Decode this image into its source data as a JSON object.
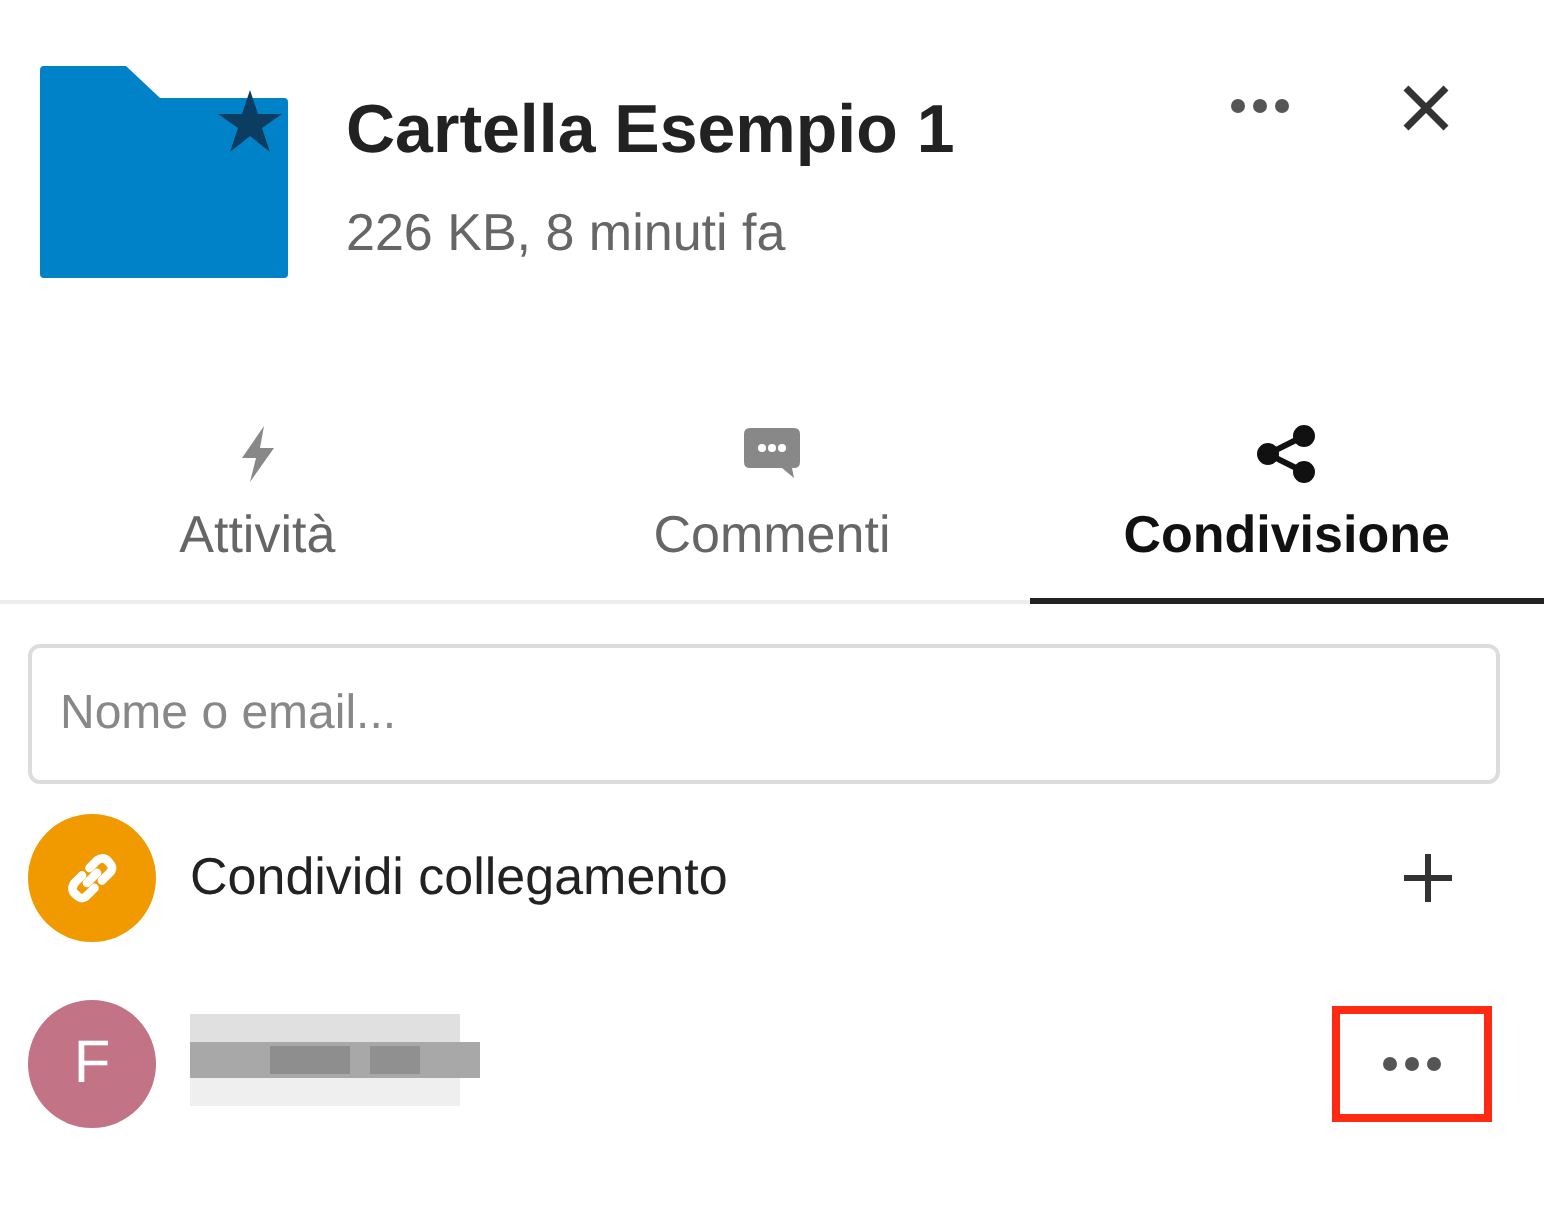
{
  "file": {
    "name": "Cartella Esempio 1",
    "details": "226 KB, 8 minuti fa",
    "favorite": true
  },
  "tabs": [
    {
      "kind": "activity",
      "label": "Attività",
      "selected": false
    },
    {
      "kind": "comments",
      "label": "Commenti",
      "selected": false
    },
    {
      "kind": "sharing",
      "label": "Condivisione",
      "selected": true
    }
  ],
  "search": {
    "placeholder": "Nome o email..."
  },
  "shares": [
    {
      "kind": "link",
      "label": "Condividi collegamento",
      "color": "#f09a00"
    },
    {
      "kind": "user",
      "initial": "F",
      "color": "#c27385",
      "highlighted": true
    }
  ]
}
